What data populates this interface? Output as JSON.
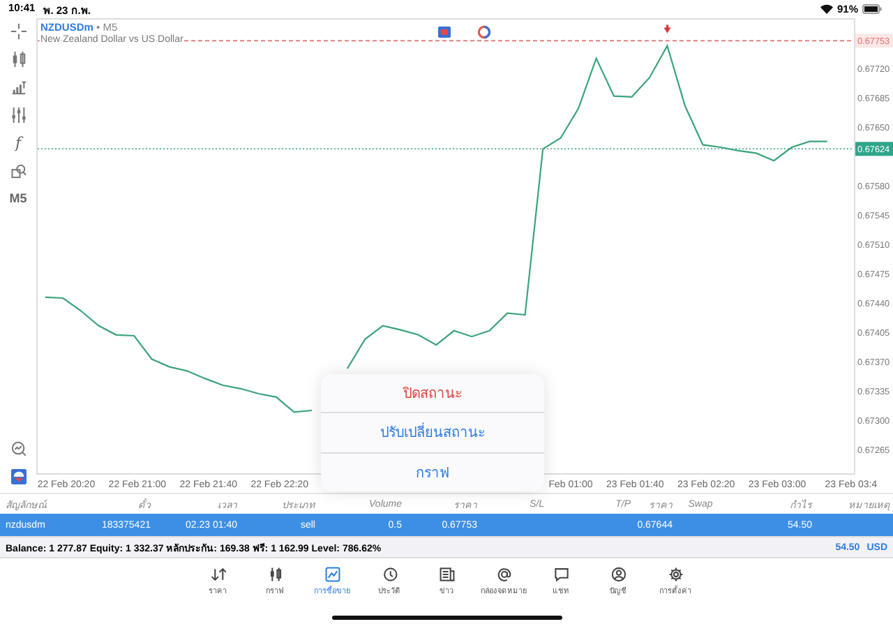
{
  "status_bar": {
    "time": "10:41",
    "date": "พ. 23 ก.พ.",
    "battery": "91%"
  },
  "toolbar": {
    "function_label": "f",
    "timeframe": "M5"
  },
  "chart": {
    "symbol": "NZDUSDm",
    "separator": "•",
    "timeframe": "M5",
    "description": "New Zealand Dollar vs US Dollar",
    "chart_data": {
      "type": "line",
      "ylim": [
        0.67237,
        0.6778
      ],
      "categories": [
        null,
        "22 Feb 20:20",
        null,
        null,
        null,
        "22 Feb 21:00",
        null,
        null,
        null,
        "22 Feb 21:40",
        null,
        null,
        null,
        "22 Feb 22:20",
        null,
        null,
        null,
        null,
        null,
        null,
        null,
        null,
        null,
        null,
        null,
        null,
        null,
        null,
        null,
        "Feb 01:00",
        null,
        null,
        null,
        "23 Feb 01:40",
        null,
        null,
        null,
        "23 Feb 02:20",
        null,
        null,
        null,
        "23 Feb 03:00",
        null,
        null,
        null,
        "23 Feb 03:4"
      ],
      "series": [
        {
          "color": "#3aa37a",
          "values": [
            0.67447,
            0.67446,
            0.67431,
            0.67413,
            0.67402,
            0.67401,
            0.67373,
            0.67364,
            0.67359,
            0.6735,
            0.67342,
            0.67338,
            0.67332,
            0.67328,
            0.6731,
            0.67312,
            null,
            0.67362,
            0.67397,
            0.67413,
            0.67408,
            0.67402,
            0.6739,
            0.67407,
            0.674,
            0.67407,
            0.67428,
            0.67426,
            0.67624,
            0.67637,
            0.67672,
            0.67732,
            0.67687,
            0.67686,
            0.67709,
            0.67747,
            0.67675,
            0.67629,
            0.67626,
            0.67622,
            0.67619,
            0.6761,
            0.67626,
            0.67633,
            0.67633,
            null
          ]
        }
      ],
      "yticks": [
        {
          "value": 0.67265,
          "label": "0.67265"
        },
        {
          "value": 0.673,
          "label": "0.67300"
        },
        {
          "value": 0.67335,
          "label": "0.67335"
        },
        {
          "value": 0.6737,
          "label": "0.67370"
        },
        {
          "value": 0.67405,
          "label": "0.67405"
        },
        {
          "value": 0.6744,
          "label": "0.67440"
        },
        {
          "value": 0.67475,
          "label": "0.67475"
        },
        {
          "value": 0.6751,
          "label": "0.67510"
        },
        {
          "value": 0.67545,
          "label": "0.67545"
        },
        {
          "value": 0.6758,
          "label": "0.67580"
        },
        {
          "value": 0.6765,
          "label": "0.67650"
        },
        {
          "value": 0.67685,
          "label": "0.67685"
        },
        {
          "value": 0.6772,
          "label": "0.67720"
        }
      ],
      "ref_lines": [
        {
          "axis": "y",
          "value": 0.67753,
          "label": "0.67753",
          "color": "#e07070"
        },
        {
          "axis": "y",
          "value": 0.67624,
          "label": "0.67624",
          "color": "#2fa58a"
        }
      ]
    }
  },
  "popup": {
    "items": [
      {
        "label": "ปิดสถานะ",
        "kind": "destructive"
      },
      {
        "label": "ปรับเปลี่ยนสถานะ",
        "kind": "default"
      },
      {
        "label": "กราฟ",
        "kind": "default"
      }
    ]
  },
  "table": {
    "columns": [
      "สัญลักษณ์",
      "ตั๋ว",
      "เวลา",
      "ประเภท",
      "Volume",
      "ราคา",
      "S/L",
      "T/P",
      "ราคา",
      "Swap",
      "กำไร",
      "หมายเหตุ"
    ],
    "rows": [
      {
        "selected": true,
        "cells": [
          "nzdusdm",
          "183375421",
          "02.23 01:40",
          "sell",
          "0.5",
          "0.67753",
          null,
          null,
          "0.67644",
          null,
          "54.50",
          null
        ]
      }
    ]
  },
  "summary": {
    "text": "Balance: 1 277.87 Equity: 1 332.37 หลักประกัน: 169.38 ฟรี: 1 162.99 Level: 786.62%",
    "profit": "54.50",
    "currency": "USD"
  },
  "tab_bar": {
    "tabs": [
      {
        "label": "ราคา",
        "selected": false
      },
      {
        "label": "กราฟ",
        "selected": false
      },
      {
        "label": "การซื้อขาย",
        "selected": true
      },
      {
        "label": "ประวัติ",
        "selected": false
      },
      {
        "label": "ข่าว",
        "selected": false
      },
      {
        "label": "กล่องจดหมาย",
        "selected": false
      },
      {
        "label": "แชท",
        "selected": false
      },
      {
        "label": "บัญชี",
        "selected": false
      },
      {
        "label": "การตั้งค่า",
        "selected": false
      }
    ]
  }
}
